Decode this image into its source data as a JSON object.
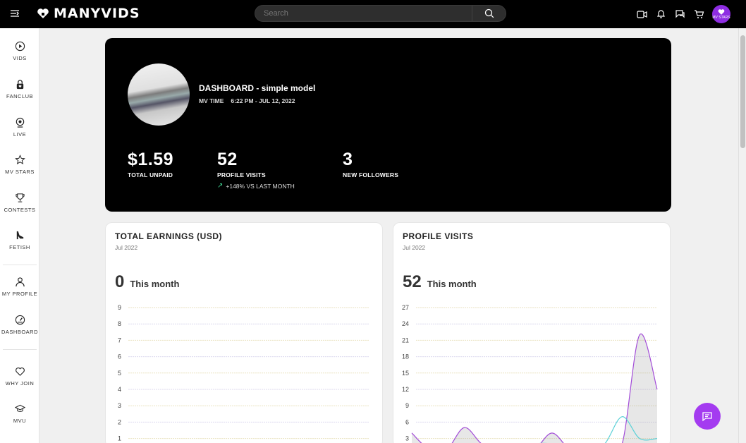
{
  "header": {
    "brand": "MANYVIDS",
    "search_placeholder": "Search",
    "avatar_text": "MV STARS"
  },
  "sidebar": {
    "items": [
      {
        "label": "VIDS",
        "icon": "play-circle-icon"
      },
      {
        "label": "FANCLUB",
        "icon": "lock-heart-icon"
      },
      {
        "label": "LIVE",
        "icon": "webcam-icon"
      },
      {
        "label": "MV STARS",
        "icon": "star-icon"
      },
      {
        "label": "CONTESTS",
        "icon": "trophy-icon"
      },
      {
        "label": "FETISH",
        "icon": "high-heel-icon"
      },
      {
        "label": "MY PROFILE",
        "icon": "user-icon"
      },
      {
        "label": "DASHBOARD",
        "icon": "gauge-icon"
      },
      {
        "label": "WHY JOIN",
        "icon": "heart-icon"
      },
      {
        "label": "MVU",
        "icon": "graduation-cap-icon"
      }
    ]
  },
  "hero": {
    "title": "DASHBOARD - simple model",
    "time_label": "MV TIME",
    "time_value": "6:22 PM - JUL 12, 2022",
    "stats": [
      {
        "value": "$1.59",
        "label": "TOTAL UNPAID"
      },
      {
        "value": "52",
        "label": "PROFILE VISITS",
        "sub": "+148% VS LAST MONTH"
      },
      {
        "value": "3",
        "label": "NEW FOLLOWERS"
      }
    ]
  },
  "cards": {
    "earnings": {
      "title": "TOTAL EARNINGS (USD)",
      "date": "Jul 2022",
      "big_value": "0",
      "big_label": "This month"
    },
    "visits": {
      "title": "PROFILE VISITS",
      "date": "Jul 2022",
      "big_value": "52",
      "big_label": "This month"
    }
  },
  "chart_data": [
    {
      "type": "line",
      "y_ticks": [
        1,
        2,
        3,
        4,
        5,
        6,
        7,
        8,
        9
      ],
      "ylim": [
        0,
        9
      ],
      "series": [
        {
          "values": [
            0,
            0,
            0,
            0,
            0,
            0,
            0,
            0,
            0,
            0,
            0,
            0
          ]
        }
      ],
      "grid": true
    },
    {
      "type": "area",
      "y_ticks": [
        3,
        6,
        9,
        12,
        15,
        18,
        21,
        24,
        27
      ],
      "ylim": [
        0,
        27
      ],
      "series": [
        {
          "values": [
            4,
            1,
            1,
            5,
            2,
            1,
            1,
            1,
            4,
            1,
            0,
            1,
            2,
            22,
            12
          ],
          "color": "#a24bd8"
        },
        {
          "values": [
            1,
            1,
            1,
            1,
            1,
            1,
            1,
            2,
            2,
            1,
            1,
            2,
            7,
            3,
            3
          ],
          "color": "#5bd1d7"
        }
      ],
      "grid": true
    }
  ],
  "colors": {
    "accent": "#a43bf0",
    "hero_bg": "#000000",
    "up_arrow": "#3ecf8e"
  }
}
